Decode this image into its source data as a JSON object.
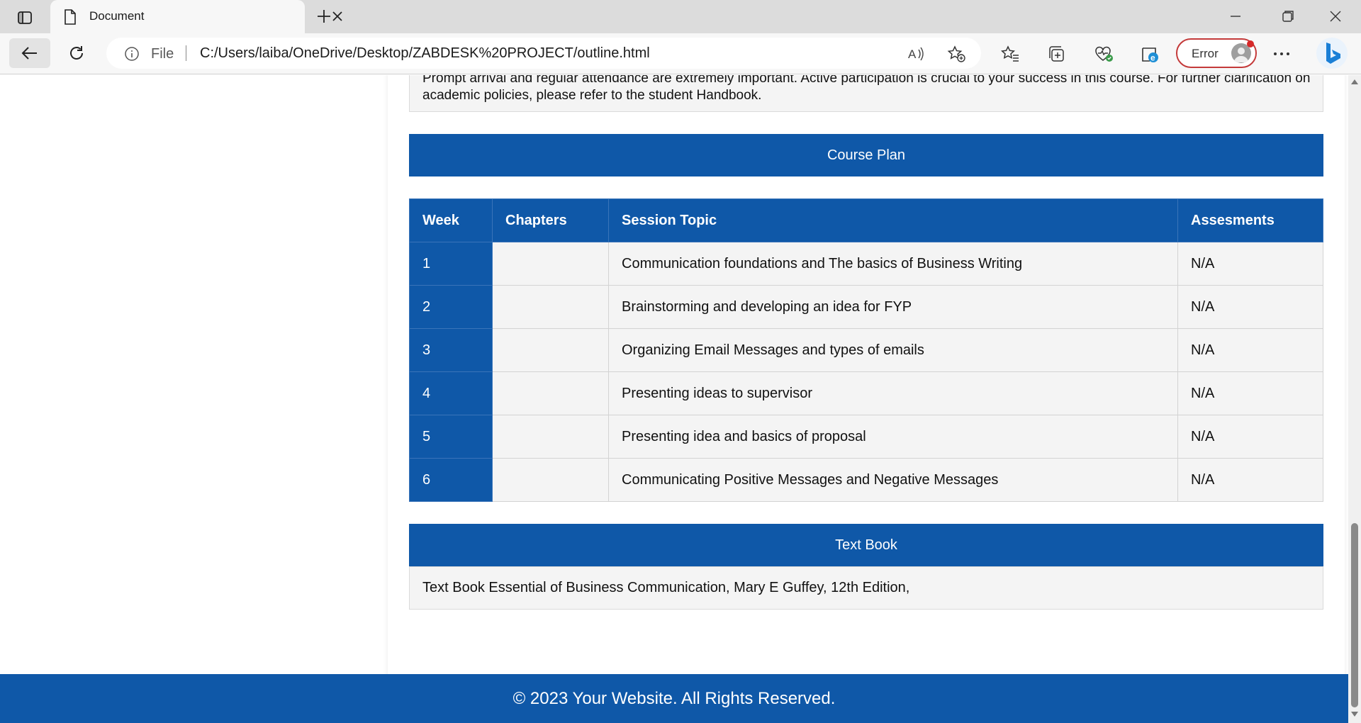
{
  "browser": {
    "tab_title": "Document",
    "address_prefix": "File",
    "url": "C:/Users/laiba/OneDrive/Desktop/ZABDESK%20PROJECT/outline.html",
    "profile_status": "Error"
  },
  "page": {
    "policy_text": "Prompt arrival and regular attendance are extremely important. Active participation is crucial to your success in this course. For further clarification on academic policies, please refer to the student Handbook.",
    "course_plan_title": "Course Plan",
    "table": {
      "headers": [
        "Week",
        "Chapters",
        "Session Topic",
        "Assesments"
      ],
      "rows": [
        {
          "week": "1",
          "chapters": "",
          "topic": "Communication foundations and The basics of Business Writing",
          "assessment": "N/A"
        },
        {
          "week": "2",
          "chapters": "",
          "topic": "Brainstorming and developing an idea for FYP",
          "assessment": "N/A"
        },
        {
          "week": "3",
          "chapters": "",
          "topic": "Organizing Email Messages and types of emails",
          "assessment": "N/A"
        },
        {
          "week": "4",
          "chapters": "",
          "topic": "Presenting ideas to supervisor",
          "assessment": "N/A"
        },
        {
          "week": "5",
          "chapters": "",
          "topic": "Presenting idea and basics of proposal",
          "assessment": "N/A"
        },
        {
          "week": "6",
          "chapters": "",
          "topic": "Communicating Positive Messages and Negative Messages",
          "assessment": "N/A"
        }
      ]
    },
    "textbook_title": "Text Book",
    "textbook_text": "Text Book Essential of Business Communication, Mary E Guffey, 12th Edition,",
    "footer_text": "© 2023 Your Website. All Rights Reserved."
  },
  "colors": {
    "accent": "#0f58a8",
    "row_bg": "#f4f4f4",
    "error_border": "#c43a3a"
  },
  "icons": [
    "tab-actions-icon",
    "document-icon",
    "close-icon",
    "plus-icon",
    "minimize-icon",
    "restore-icon",
    "window-close-icon",
    "back-arrow-icon",
    "reload-icon",
    "info-icon",
    "read-aloud-icon",
    "add-favorite-icon",
    "favorites-icon",
    "collections-icon",
    "browser-essentials-icon",
    "copilot-icon",
    "avatar-icon",
    "more-icon",
    "bing-icon"
  ]
}
